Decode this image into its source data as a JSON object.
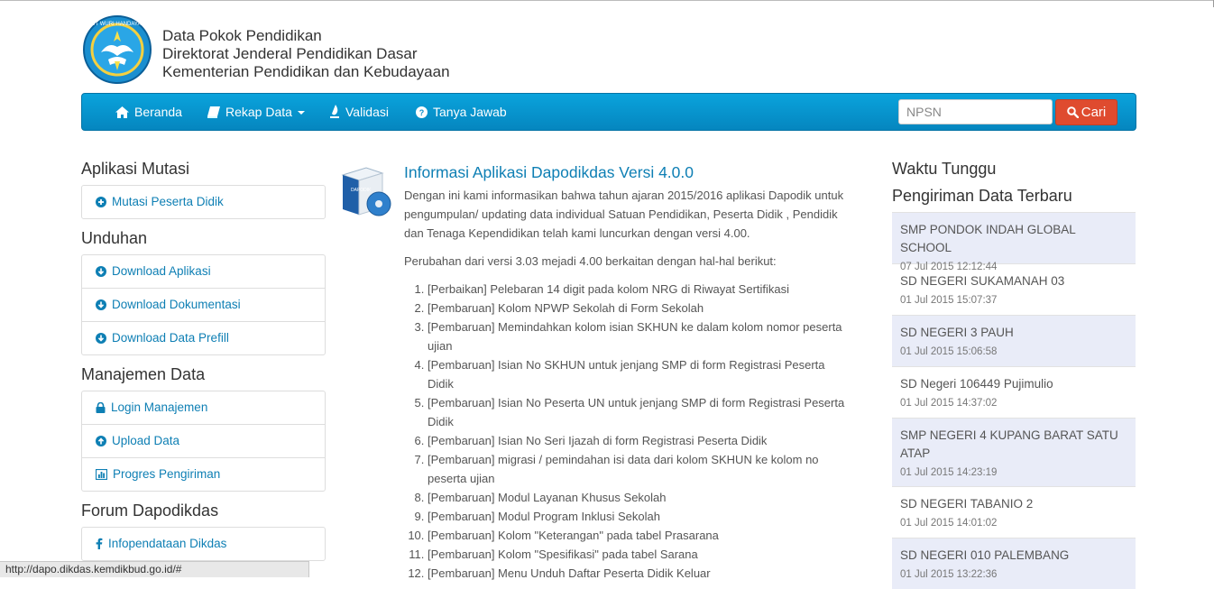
{
  "header": {
    "line1": "Data Pokok Pendidikan",
    "line2": "Direktorat Jenderal Pendidikan Dasar",
    "line3": "Kementerian Pendidikan dan Kebudayaan",
    "logo_text": "TUT WURI HANDAYANI"
  },
  "nav": {
    "beranda": "Beranda",
    "rekap": "Rekap Data",
    "validasi": "Validasi",
    "tanya": "Tanya Jawab",
    "search_placeholder": "NPSN",
    "search_button": "Cari",
    "accent": "#0a9ad5"
  },
  "left": {
    "mutasi_title": "Aplikasi Mutasi",
    "mutasi_items": [
      "Mutasi Peserta Didik"
    ],
    "unduhan_title": "Unduhan",
    "unduhan_items": [
      "Download Aplikasi",
      "Download Dokumentasi",
      "Download Data Prefill"
    ],
    "manajemen_title": "Manajemen Data",
    "manajemen_items": [
      "Login Manajemen",
      "Upload Data",
      "Progres Pengiriman"
    ],
    "forum_title": "Forum Dapodikdas",
    "forum_items": [
      "Infopendataan Dikdas"
    ]
  },
  "main": {
    "box_label": "DAPODIK",
    "title": "Informasi Aplikasi Dapodikdas Versi 4.0.0",
    "intro": "Dengan ini kami informasikan bahwa tahun ajaran 2015/2016 aplikasi Dapodik untuk pengumpulan/ updating data individual Satuan Pendidikan, Peserta Didik , Pendidik dan Tenaga Kependidikan telah kami luncurkan dengan versi 4.00.",
    "changes_intro": "Perubahan dari versi 3.03 mejadi 4.00 berkaitan dengan hal-hal berikut:",
    "changes": [
      "[Perbaikan] Pelebaran 14 digit pada kolom NRG di Riwayat Sertifikasi",
      "[Pembaruan] Kolom NPWP Sekolah di Form Sekolah",
      "[Pembaruan] Memindahkan kolom isian SKHUN ke dalam kolom nomor peserta ujian",
      "[Pembaruan] Isian No SKHUN untuk jenjang SMP di form Registrasi Peserta Didik",
      "[Pembaruan] Isian No Peserta UN untuk jenjang SMP di form Registrasi Peserta Didik",
      "[Pembaruan] Isian No Seri Ijazah di form Registrasi Peserta Didik",
      "[Pembaruan] migrasi / pemindahan isi data dari kolom SKHUN ke kolom no peserta ujian",
      "[Pembaruan] Modul Layanan Khusus Sekolah",
      "[Pembaruan] Modul Program Inklusi Sekolah",
      "[Pembaruan] Kolom \"Keterangan\" pada tabel Prasarana",
      "[Pembaruan] Kolom \"Spesifikasi\" pada tabel Sarana",
      "[Pembaruan] Menu Unduh Daftar Peserta Didik Keluar"
    ]
  },
  "right": {
    "title1": "Waktu Tunggu",
    "title2": "Pengiriman Data Terbaru",
    "items": [
      {
        "name": "SMP PONDOK INDAH GLOBAL SCHOOL",
        "time": "07 Jul 2015 12:12:44"
      },
      {
        "name": "SD NEGERI SUKAMANAH 03",
        "time": "01 Jul 2015 15:07:37"
      },
      {
        "name": "SD NEGERI 3 PAUH",
        "time": "01 Jul 2015 15:06:58"
      },
      {
        "name": "SD Negeri 106449 Pujimulio",
        "time": "01 Jul 2015 14:37:02"
      },
      {
        "name": "SMP NEGERI 4 KUPANG BARAT SATU ATAP",
        "time": "01 Jul 2015 14:23:19"
      },
      {
        "name": "SD NEGERI TABANIO 2",
        "time": "01 Jul 2015 14:01:02"
      },
      {
        "name": "SD NEGERI 010 PALEMBANG",
        "time": "01 Jul 2015 13:22:36"
      }
    ]
  },
  "status": {
    "url": "http://dapo.dikdas.kemdikbud.go.id/#"
  }
}
